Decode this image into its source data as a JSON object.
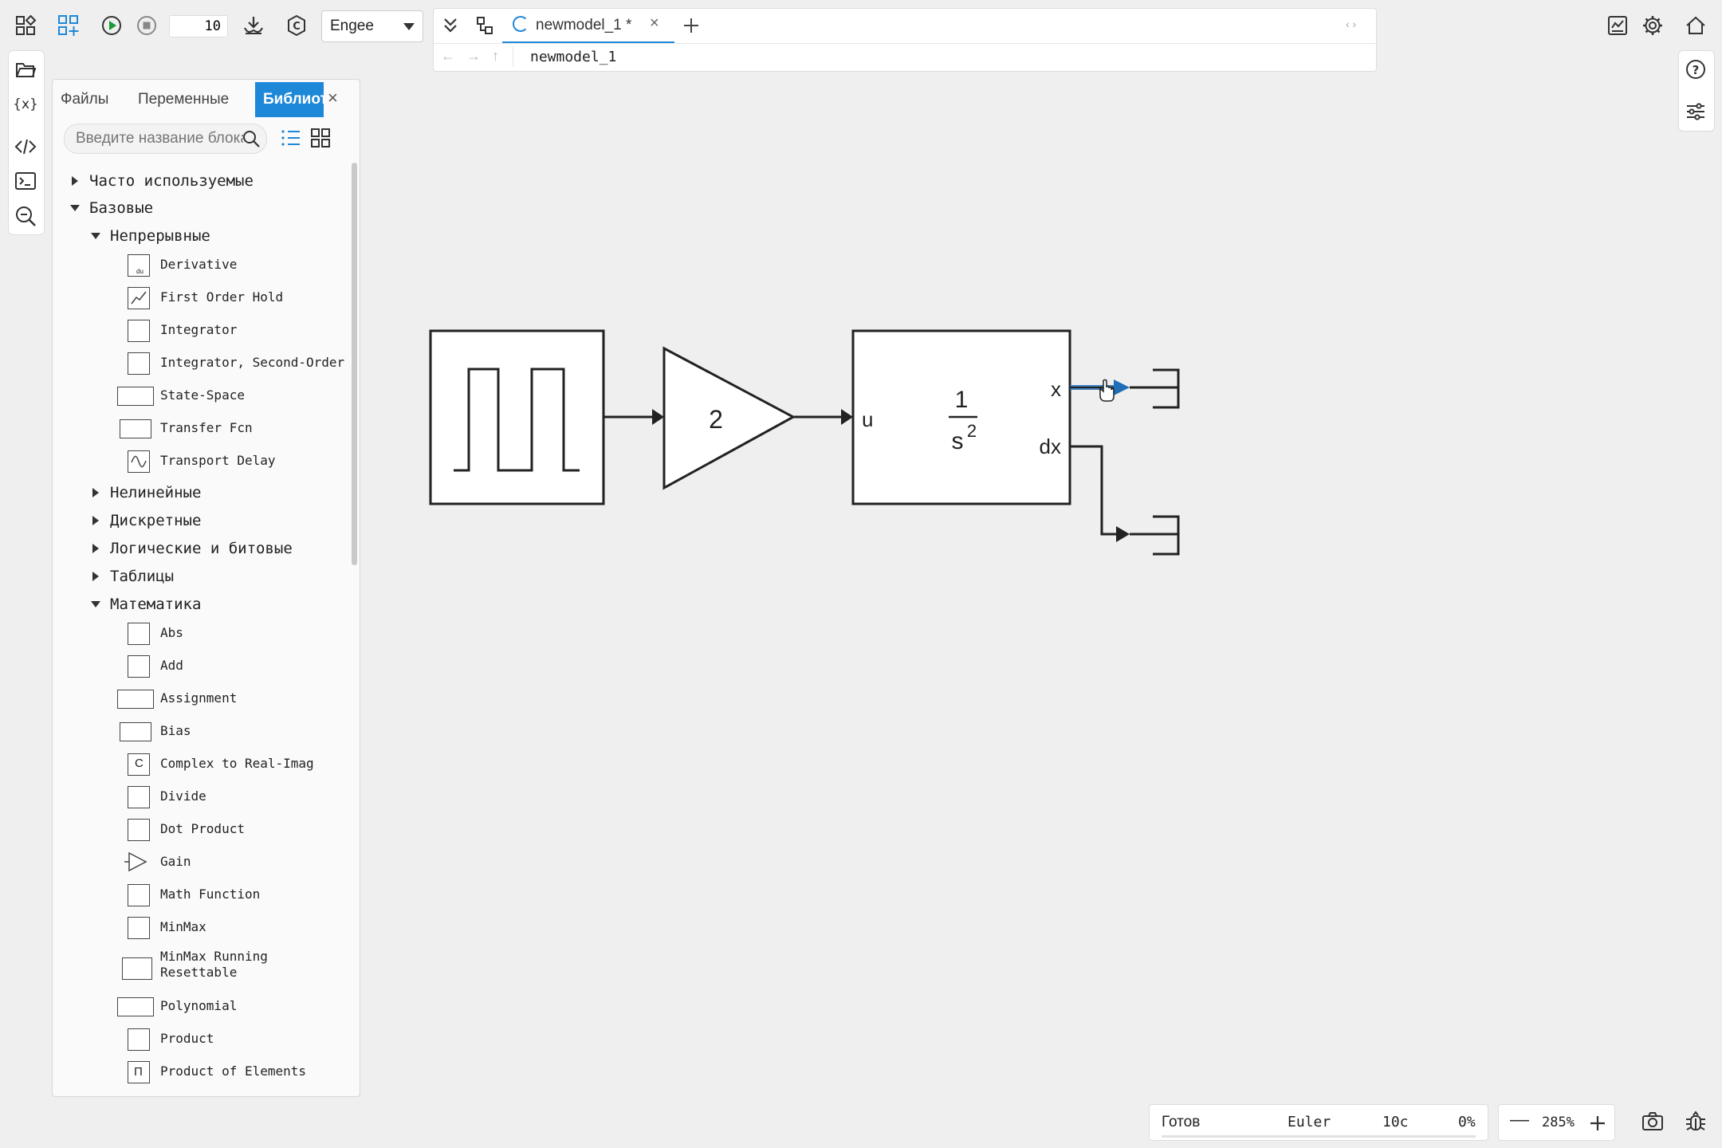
{
  "toolbar": {
    "sim_time_value": "10",
    "solver_select": "Engee"
  },
  "tabs": [
    {
      "label": "newmodel_1 *"
    }
  ],
  "breadcrumb": {
    "path": "newmodel_1"
  },
  "library_panel": {
    "tabs": [
      "Файлы",
      "Переменные",
      "Библиот"
    ],
    "active_tab": "Библиот",
    "search_placeholder": "Введите название блока",
    "groups": {
      "frequent": "Часто используемые",
      "basic": "Базовые",
      "continuous": "Непрерывные",
      "nonlinear": "Нелинейные",
      "discrete": "Дискретные",
      "logic": "Логические и битовые",
      "tables": "Таблицы",
      "math": "Математика"
    },
    "continuous_items": [
      "Derivative",
      "First Order Hold",
      "Integrator",
      "Integrator, Second-Order",
      "State-Space",
      "Transfer Fcn",
      "Transport Delay"
    ],
    "math_items": [
      "Abs",
      "Add",
      "Assignment",
      "Bias",
      "Complex to Real-Imag",
      "Divide",
      "Dot Product",
      "Gain",
      "Math Function",
      "MinMax",
      "MinMax Running Resettable",
      "Polynomial",
      "Product",
      "Product of Elements"
    ]
  },
  "canvas": {
    "gain_value": "2",
    "integrator_num": "1",
    "integrator_den": "s",
    "integrator_den_exp": "2",
    "port_in": "u",
    "port_out1": "x",
    "port_out2": "dx"
  },
  "status": {
    "state": "Готов",
    "solver": "Euler",
    "time": "10с",
    "progress": "0%",
    "progress_value": 0
  },
  "zoom": {
    "level": "285%"
  },
  "icons": {
    "accent": "#1e88d8"
  }
}
